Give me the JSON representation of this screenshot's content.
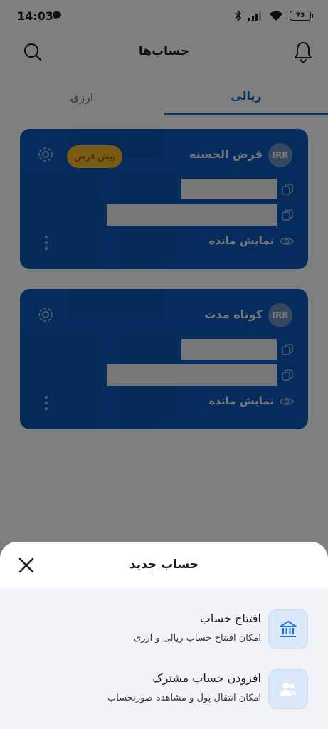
{
  "status_bar": {
    "time": "14:03",
    "battery": "73"
  },
  "header": {
    "title": "حساب‌ها"
  },
  "tabs": [
    {
      "label": "ریالی",
      "active": true
    },
    {
      "label": "ارزی",
      "active": false
    }
  ],
  "accounts": [
    {
      "currency": "IRR",
      "name": "قرض الحسنه",
      "default_badge": "پیش فرض",
      "balance_label": "نمایش مانده"
    },
    {
      "currency": "IRR",
      "name": "کوتاه مدت",
      "balance_label": "نمایش مانده"
    }
  ],
  "sheet": {
    "title": "حساب جدید",
    "options": [
      {
        "title": "افتتاح حساب",
        "subtitle": "امکان افتتاح حساب ریالی و ارزی",
        "icon": "bank-icon"
      },
      {
        "title": "افزودن حساب مشترک",
        "subtitle": "امکان انتقال پول و مشاهده صورتحساب",
        "icon": "users-icon"
      }
    ]
  },
  "colors": {
    "accent": "#1565c0",
    "card": "#0a58b8",
    "badge": "#f0b428",
    "sheet_bg": "#f2f3f8"
  }
}
